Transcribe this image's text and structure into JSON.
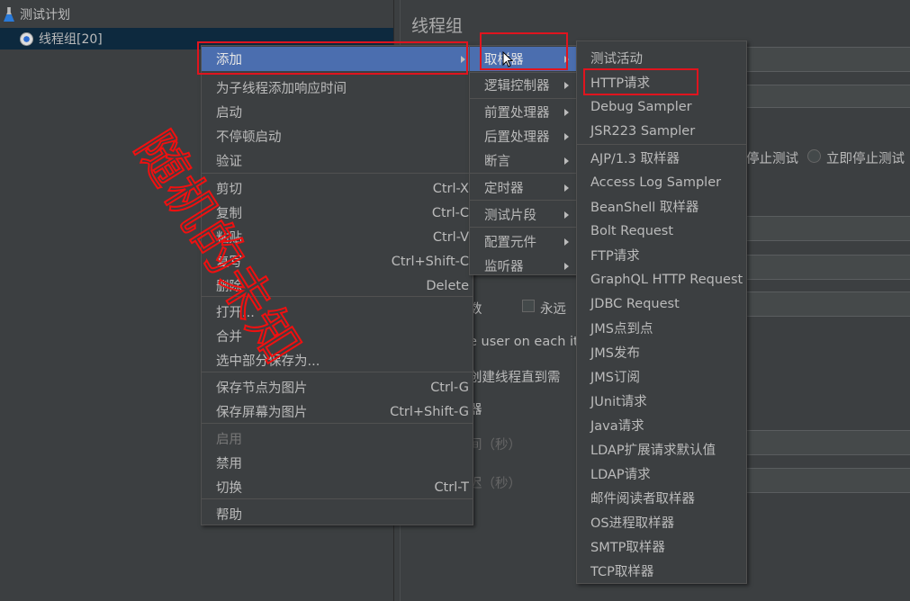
{
  "tree": {
    "root": {
      "label": "测试计划",
      "icon": "flask-icon"
    },
    "child": {
      "label": "线程组[20]",
      "icon": "gear-icon"
    }
  },
  "panel": {
    "title": "线程组",
    "stop_test": "停止测试",
    "stop_now": "立即停止测试",
    "loop_frag": "数",
    "forever": "永远",
    "same_user": "e user on each it",
    "delay_create": "创建线程直到需",
    "scheduler": "器",
    "duration": "间（秒）",
    "startup_delay": "迟（秒）"
  },
  "context_menu": {
    "items": [
      {
        "label": "添加",
        "submenu": true,
        "highlighted": true
      },
      {
        "label": "为子线程添加响应时间"
      },
      {
        "label": "启动"
      },
      {
        "label": "不停顿启动"
      },
      {
        "label": "验证"
      },
      {
        "label": "剪切",
        "shortcut": "Ctrl-X"
      },
      {
        "label": "复制",
        "shortcut": "Ctrl-C"
      },
      {
        "label": "粘贴",
        "shortcut": "Ctrl-V"
      },
      {
        "label": "复写",
        "shortcut": "Ctrl+Shift-C"
      },
      {
        "label": "删除",
        "shortcut": "Delete"
      },
      {
        "label": "打开..."
      },
      {
        "label": "合并"
      },
      {
        "label": "选中部分保存为..."
      },
      {
        "label": "保存节点为图片",
        "shortcut": "Ctrl-G"
      },
      {
        "label": "保存屏幕为图片",
        "shortcut": "Ctrl+Shift-G"
      },
      {
        "label": "启用",
        "disabled": true
      },
      {
        "label": "禁用"
      },
      {
        "label": "切换",
        "shortcut": "Ctrl-T"
      },
      {
        "label": "帮助"
      }
    ]
  },
  "add_submenu": {
    "items": [
      {
        "label": "取样器",
        "highlighted": true
      },
      {
        "label": "逻辑控制器"
      },
      {
        "label": "前置处理器"
      },
      {
        "label": "后置处理器"
      },
      {
        "label": "断言"
      },
      {
        "label": "定时器"
      },
      {
        "label": "测试片段"
      },
      {
        "label": "配置元件"
      },
      {
        "label": "监听器"
      }
    ]
  },
  "sampler_submenu": {
    "items": [
      "测试活动",
      "HTTP请求",
      "Debug Sampler",
      "JSR223 Sampler",
      "AJP/1.3 取样器",
      "Access Log Sampler",
      "BeanShell 取样器",
      "Bolt Request",
      "FTP请求",
      "GraphQL HTTP Request",
      "JDBC Request",
      "JMS点到点",
      "JMS发布",
      "JMS订阅",
      "JUnit请求",
      "Java请求",
      "LDAP扩展请求默认值",
      "LDAP请求",
      "邮件阅读者取样器",
      "OS进程取样器",
      "SMTP取样器",
      "TCP取样器"
    ]
  },
  "watermark": "随机的未知",
  "colors": {
    "highlight": "#4b6eaf",
    "annotation": "#e0141e",
    "selection": "#0d293e"
  }
}
